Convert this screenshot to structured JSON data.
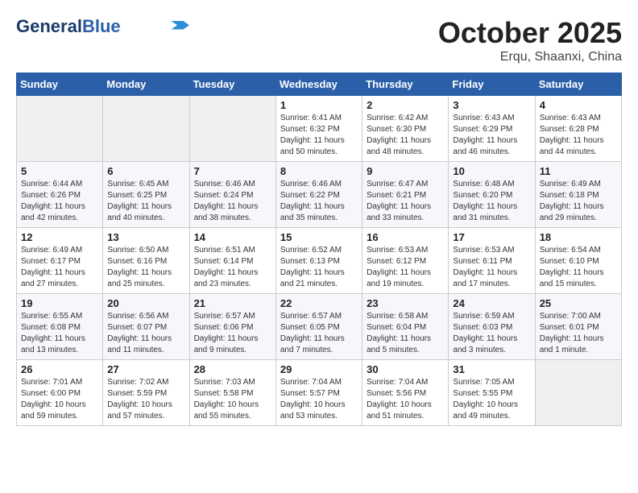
{
  "header": {
    "logo_general": "General",
    "logo_blue": "Blue",
    "title": "October 2025",
    "subtitle": "Erqu, Shaanxi, China"
  },
  "weekdays": [
    "Sunday",
    "Monday",
    "Tuesday",
    "Wednesday",
    "Thursday",
    "Friday",
    "Saturday"
  ],
  "weeks": [
    [
      {
        "day": "",
        "info": ""
      },
      {
        "day": "",
        "info": ""
      },
      {
        "day": "",
        "info": ""
      },
      {
        "day": "1",
        "info": "Sunrise: 6:41 AM\nSunset: 6:32 PM\nDaylight: 11 hours\nand 50 minutes."
      },
      {
        "day": "2",
        "info": "Sunrise: 6:42 AM\nSunset: 6:30 PM\nDaylight: 11 hours\nand 48 minutes."
      },
      {
        "day": "3",
        "info": "Sunrise: 6:43 AM\nSunset: 6:29 PM\nDaylight: 11 hours\nand 46 minutes."
      },
      {
        "day": "4",
        "info": "Sunrise: 6:43 AM\nSunset: 6:28 PM\nDaylight: 11 hours\nand 44 minutes."
      }
    ],
    [
      {
        "day": "5",
        "info": "Sunrise: 6:44 AM\nSunset: 6:26 PM\nDaylight: 11 hours\nand 42 minutes."
      },
      {
        "day": "6",
        "info": "Sunrise: 6:45 AM\nSunset: 6:25 PM\nDaylight: 11 hours\nand 40 minutes."
      },
      {
        "day": "7",
        "info": "Sunrise: 6:46 AM\nSunset: 6:24 PM\nDaylight: 11 hours\nand 38 minutes."
      },
      {
        "day": "8",
        "info": "Sunrise: 6:46 AM\nSunset: 6:22 PM\nDaylight: 11 hours\nand 35 minutes."
      },
      {
        "day": "9",
        "info": "Sunrise: 6:47 AM\nSunset: 6:21 PM\nDaylight: 11 hours\nand 33 minutes."
      },
      {
        "day": "10",
        "info": "Sunrise: 6:48 AM\nSunset: 6:20 PM\nDaylight: 11 hours\nand 31 minutes."
      },
      {
        "day": "11",
        "info": "Sunrise: 6:49 AM\nSunset: 6:18 PM\nDaylight: 11 hours\nand 29 minutes."
      }
    ],
    [
      {
        "day": "12",
        "info": "Sunrise: 6:49 AM\nSunset: 6:17 PM\nDaylight: 11 hours\nand 27 minutes."
      },
      {
        "day": "13",
        "info": "Sunrise: 6:50 AM\nSunset: 6:16 PM\nDaylight: 11 hours\nand 25 minutes."
      },
      {
        "day": "14",
        "info": "Sunrise: 6:51 AM\nSunset: 6:14 PM\nDaylight: 11 hours\nand 23 minutes."
      },
      {
        "day": "15",
        "info": "Sunrise: 6:52 AM\nSunset: 6:13 PM\nDaylight: 11 hours\nand 21 minutes."
      },
      {
        "day": "16",
        "info": "Sunrise: 6:53 AM\nSunset: 6:12 PM\nDaylight: 11 hours\nand 19 minutes."
      },
      {
        "day": "17",
        "info": "Sunrise: 6:53 AM\nSunset: 6:11 PM\nDaylight: 11 hours\nand 17 minutes."
      },
      {
        "day": "18",
        "info": "Sunrise: 6:54 AM\nSunset: 6:10 PM\nDaylight: 11 hours\nand 15 minutes."
      }
    ],
    [
      {
        "day": "19",
        "info": "Sunrise: 6:55 AM\nSunset: 6:08 PM\nDaylight: 11 hours\nand 13 minutes."
      },
      {
        "day": "20",
        "info": "Sunrise: 6:56 AM\nSunset: 6:07 PM\nDaylight: 11 hours\nand 11 minutes."
      },
      {
        "day": "21",
        "info": "Sunrise: 6:57 AM\nSunset: 6:06 PM\nDaylight: 11 hours\nand 9 minutes."
      },
      {
        "day": "22",
        "info": "Sunrise: 6:57 AM\nSunset: 6:05 PM\nDaylight: 11 hours\nand 7 minutes."
      },
      {
        "day": "23",
        "info": "Sunrise: 6:58 AM\nSunset: 6:04 PM\nDaylight: 11 hours\nand 5 minutes."
      },
      {
        "day": "24",
        "info": "Sunrise: 6:59 AM\nSunset: 6:03 PM\nDaylight: 11 hours\nand 3 minutes."
      },
      {
        "day": "25",
        "info": "Sunrise: 7:00 AM\nSunset: 6:01 PM\nDaylight: 11 hours\nand 1 minute."
      }
    ],
    [
      {
        "day": "26",
        "info": "Sunrise: 7:01 AM\nSunset: 6:00 PM\nDaylight: 10 hours\nand 59 minutes."
      },
      {
        "day": "27",
        "info": "Sunrise: 7:02 AM\nSunset: 5:59 PM\nDaylight: 10 hours\nand 57 minutes."
      },
      {
        "day": "28",
        "info": "Sunrise: 7:03 AM\nSunset: 5:58 PM\nDaylight: 10 hours\nand 55 minutes."
      },
      {
        "day": "29",
        "info": "Sunrise: 7:04 AM\nSunset: 5:57 PM\nDaylight: 10 hours\nand 53 minutes."
      },
      {
        "day": "30",
        "info": "Sunrise: 7:04 AM\nSunset: 5:56 PM\nDaylight: 10 hours\nand 51 minutes."
      },
      {
        "day": "31",
        "info": "Sunrise: 7:05 AM\nSunset: 5:55 PM\nDaylight: 10 hours\nand 49 minutes."
      },
      {
        "day": "",
        "info": ""
      }
    ]
  ]
}
